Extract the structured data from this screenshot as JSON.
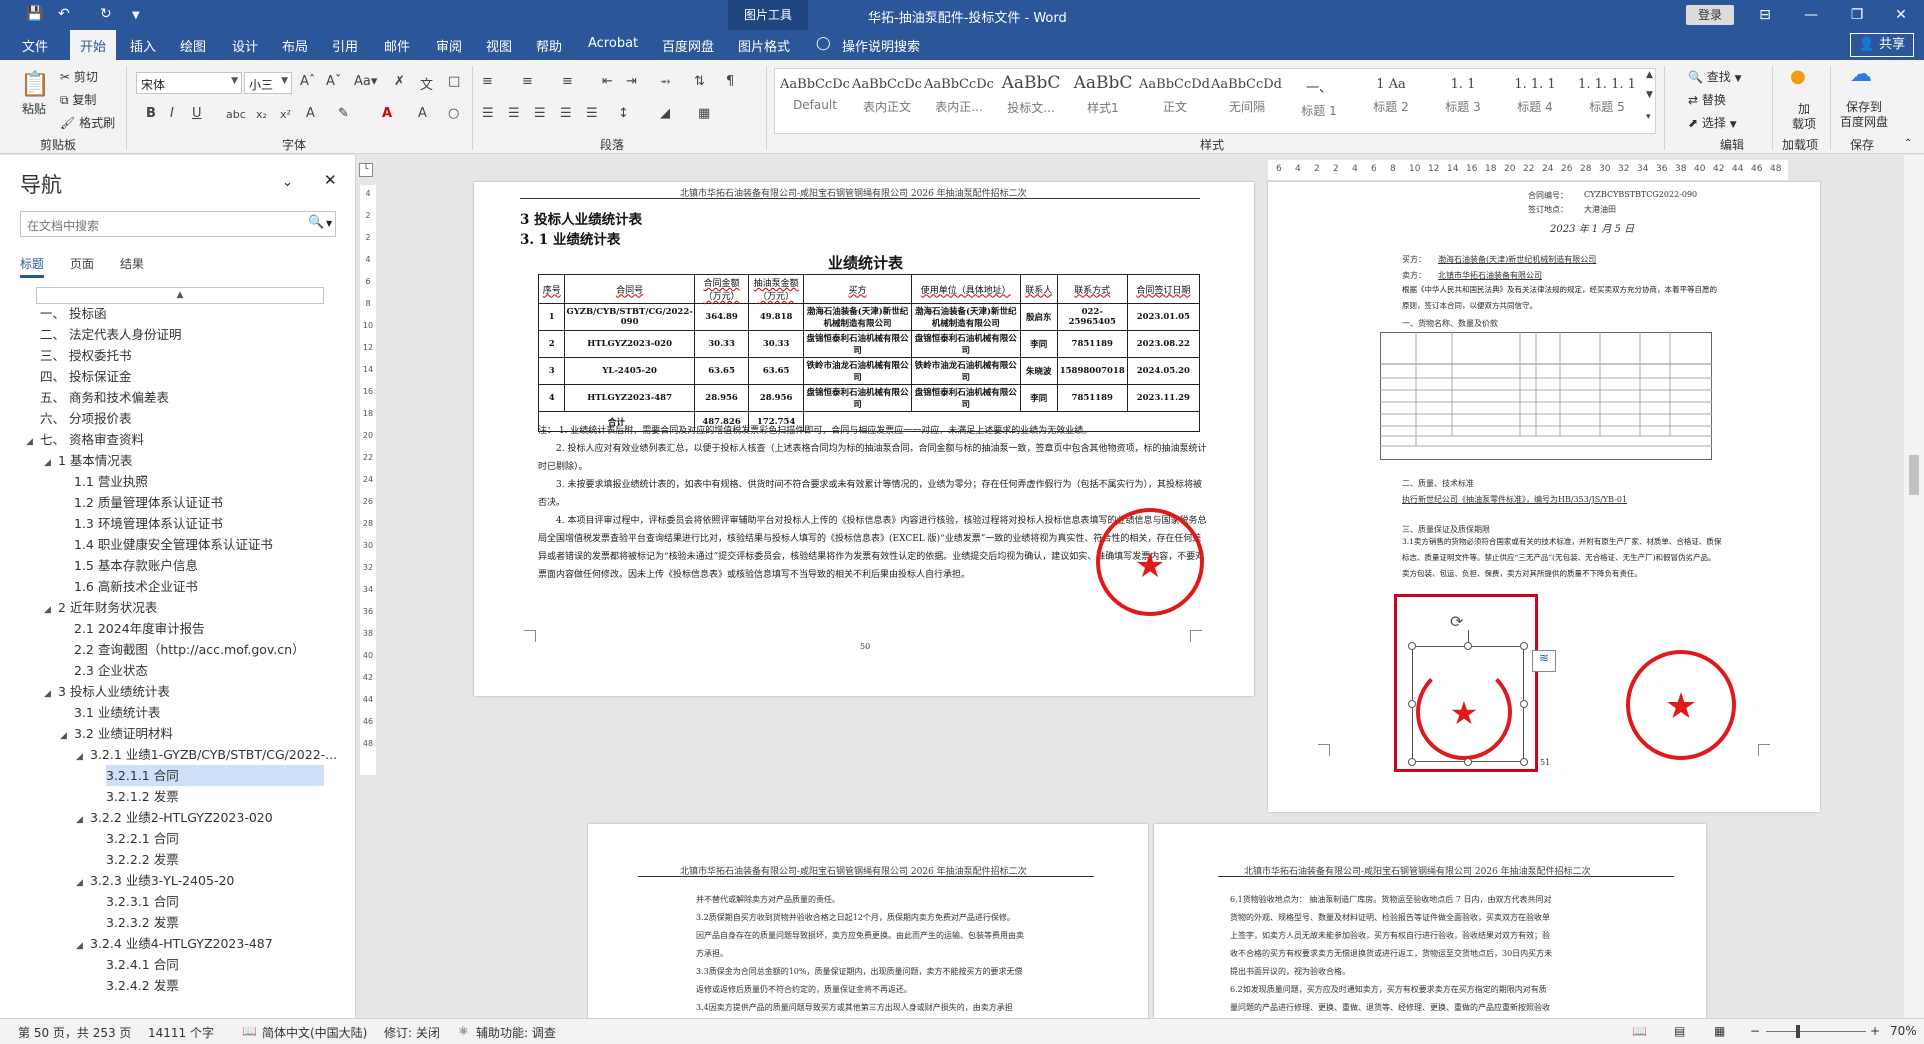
{
  "titlebar": {
    "context_tab": "图片工具",
    "doc_title": "华拓-抽油泵配件-投标文件  -  Word",
    "login": "登录",
    "min": "—",
    "restore": "❐",
    "close": "✕",
    "ribbon_opts": "⊟"
  },
  "tabs": [
    {
      "label": "文件"
    },
    {
      "label": "开始"
    },
    {
      "label": "插入"
    },
    {
      "label": "绘图"
    },
    {
      "label": "设计"
    },
    {
      "label": "布局"
    },
    {
      "label": "引用"
    },
    {
      "label": "邮件"
    },
    {
      "label": "审阅"
    },
    {
      "label": "视图"
    },
    {
      "label": "帮助"
    },
    {
      "label": "Acrobat"
    },
    {
      "label": "百度网盘"
    },
    {
      "label": "图片格式"
    }
  ],
  "tellme": "操作说明搜索",
  "share": "共享",
  "ribbon": {
    "clipboard": {
      "paste": "粘贴",
      "cut": "剪切",
      "copy": "复制",
      "painter": "格式刷",
      "label": "剪贴板"
    },
    "font": {
      "family": "宋体",
      "size": "小三",
      "label": "字体"
    },
    "paragraph": {
      "label": "段落"
    },
    "styles": {
      "label": "样式",
      "items": [
        {
          "sample": "AaBbCcDc",
          "name": "Default"
        },
        {
          "sample": "AaBbCcDc",
          "name": "表内正文"
        },
        {
          "sample": "AaBbCcDc",
          "name": "表内正..."
        },
        {
          "sample": "AaBbC",
          "name": "投标文..."
        },
        {
          "sample": "AaBbC",
          "name": "样式1"
        },
        {
          "sample": "AaBbCcDdI",
          "name": "正文"
        },
        {
          "sample": "AaBbCcDdI",
          "name": "无间隔"
        },
        {
          "sample": "一、",
          "name": "标题 1"
        },
        {
          "sample": "1  Aa",
          "name": "标题 2"
        },
        {
          "sample": "1. 1",
          "name": "标题 3"
        },
        {
          "sample": "1. 1. 1",
          "name": "标题 4"
        },
        {
          "sample": "1. 1. 1. 1",
          "name": "标题 5"
        }
      ]
    },
    "editing": {
      "find": "查找",
      "replace": "替换",
      "select": "选择",
      "label": "编辑"
    },
    "addins": {
      "name": "加\n载项",
      "label": "加载项"
    },
    "save": {
      "name": "保存到\n百度网盘",
      "label": "保存"
    }
  },
  "nav": {
    "title": "导航",
    "search_placeholder": "在文档中搜索",
    "tabs": [
      "标题",
      "页面",
      "结果"
    ],
    "collapse_glyph": "▲",
    "items": [
      {
        "text": "一、 投标函",
        "indent": 0,
        "tri": ""
      },
      {
        "text": "二、 法定代表人身份证明",
        "indent": 0,
        "tri": ""
      },
      {
        "text": "三、 授权委托书",
        "indent": 0,
        "tri": ""
      },
      {
        "text": "四、 投标保证金",
        "indent": 0,
        "tri": ""
      },
      {
        "text": "五、 商务和技术偏差表",
        "indent": 0,
        "tri": ""
      },
      {
        "text": "六、 分项报价表",
        "indent": 0,
        "tri": ""
      },
      {
        "text": "七、 资格审查资料",
        "indent": 0,
        "tri": "◢"
      },
      {
        "text": "1 基本情况表",
        "indent": 1,
        "tri": "◢"
      },
      {
        "text": "1.1 营业执照",
        "indent": 2,
        "tri": ""
      },
      {
        "text": "1.2 质量管理体系认证证书",
        "indent": 2,
        "tri": ""
      },
      {
        "text": "1.3 环境管理体系认证证书",
        "indent": 2,
        "tri": ""
      },
      {
        "text": "1.4 职业健康安全管理体系认证证书",
        "indent": 2,
        "tri": ""
      },
      {
        "text": "1.5 基本存款账户信息",
        "indent": 2,
        "tri": ""
      },
      {
        "text": "1.6 高新技术企业证书",
        "indent": 2,
        "tri": ""
      },
      {
        "text": "2 近年财务状况表",
        "indent": 1,
        "tri": "◢"
      },
      {
        "text": "2.1 2024年度审计报告",
        "indent": 2,
        "tri": ""
      },
      {
        "text": "2.2 查询截图（http://acc.mof.gov.cn）",
        "indent": 2,
        "tri": ""
      },
      {
        "text": "2.3 企业状态",
        "indent": 2,
        "tri": ""
      },
      {
        "text": "3 投标人业绩统计表",
        "indent": 1,
        "tri": "◢"
      },
      {
        "text": "3.1 业绩统计表",
        "indent": 2,
        "tri": ""
      },
      {
        "text": "3.2 业绩证明材料",
        "indent": 2,
        "tri": "◢"
      },
      {
        "text": "3.2.1 业绩1-GYZB/CYB/STBT/CG/2022-...",
        "indent": 3,
        "tri": "◢"
      },
      {
        "text": "3.2.1.1 合同",
        "indent": 4,
        "tri": "",
        "selected": true
      },
      {
        "text": "3.2.1.2 发票",
        "indent": 4,
        "tri": ""
      },
      {
        "text": "3.2.2 业绩2-HTLGYZ2023-020",
        "indent": 3,
        "tri": "◢"
      },
      {
        "text": "3.2.2.1 合同",
        "indent": 4,
        "tri": ""
      },
      {
        "text": "3.2.2.2 发票",
        "indent": 4,
        "tri": ""
      },
      {
        "text": "3.2.3 业绩3-YL-2405-20",
        "indent": 3,
        "tri": "◢"
      },
      {
        "text": "3.2.3.1 合同",
        "indent": 4,
        "tri": ""
      },
      {
        "text": "3.2.3.2 发票",
        "indent": 4,
        "tri": ""
      },
      {
        "text": "3.2.4 业绩4-HTLGYZ2023-487",
        "indent": 3,
        "tri": "◢"
      },
      {
        "text": "3.2.4.1 合同",
        "indent": 4,
        "tri": ""
      },
      {
        "text": "3.2.4.2 发票",
        "indent": 4,
        "tri": ""
      }
    ]
  },
  "vruler": [
    "4",
    "2",
    "2",
    "4",
    "6",
    "8",
    "10",
    "12",
    "14",
    "16",
    "18",
    "20",
    "22",
    "24",
    "26",
    "28",
    "30",
    "32",
    "34",
    "36",
    "38",
    "40",
    "42",
    "44",
    "46",
    "48"
  ],
  "hruler": [
    "6",
    "4",
    "2",
    "2",
    "4",
    "6",
    "8",
    "10",
    "12",
    "14",
    "16",
    "18",
    "20",
    "22",
    "24",
    "26",
    "28",
    "30",
    "32",
    "34",
    "36",
    "38",
    "40",
    "42",
    "44",
    "46",
    "48"
  ],
  "page50": {
    "header": "北镇市华拓石油装备有限公司-咸阳宝石钢管钢绳有限公司 2026 年抽油泵配件招标二次",
    "h1": "3 投标人业绩统计表",
    "h2": "3. 1 业绩统计表",
    "table_title": "业绩统计表",
    "columns": [
      "序号",
      "合同号",
      "合同金额（万元）",
      "抽油泵金额（万元）",
      "买方",
      "使用单位（具体地址）",
      "联系人",
      "联系方式",
      "合同签订日期"
    ],
    "rows": [
      [
        "1",
        "GYZB/CYB/STBT/CG/2022-090",
        "364.89",
        "49.818",
        "渤海石油装备(天津)新世纪机械制造有限公司",
        "渤海石油装备(天津)新世纪机械制造有限公司",
        "殷启东",
        "022-25965405",
        "2023.01.05"
      ],
      [
        "2",
        "HTLGYZ2023-020",
        "30.33",
        "30.33",
        "盘锦恒泰利石油机械有限公司",
        "盘锦恒泰利石油机械有限公司",
        "李同",
        "7851189",
        "2023.08.22"
      ],
      [
        "3",
        "YL-2405-20",
        "63.65",
        "63.65",
        "铁岭市油龙石油机械有限公司",
        "铁岭市油龙石油机械有限公司",
        "朱晓波",
        "15898007018",
        "2024.05.20"
      ],
      [
        "4",
        "HTLGYZ2023-487",
        "28.956",
        "28.956",
        "盘锦恒泰利石油机械有限公司",
        "盘锦恒泰利石油机械有限公司",
        "李同",
        "7851189",
        "2023.11.29"
      ]
    ],
    "total_label": "合计",
    "total_contract": "487.826",
    "total_pump": "172.754",
    "notes": [
      "注：  1. 业绩统计表后附，需要合同及对应的增值税发票彩色扫描件即可，合同与相应发票应一一对应，未满足上述要求的业绩为无效业绩。",
      "2. 投标人应对有效业绩列表汇总，以便于投标人核查（上述表格合同均为标的抽油泵合同，合同金额与标的抽油泵一致，签章页中包含其他物资项，标的抽油泵统计时已剔除）。",
      "3. 未按要求填报业绩统计表的，如表中有规格、供货时间不符合要求或未有效累计等情况的，业绩为零分；存在任何弄虚作假行为（包括不属实行为），其投标将被否决。",
      "4. 本项目评审过程中，评标委员会将依照评审辅助平台对投标人上传的《投标信息表》内容进行核验，核验过程将对投标人投标信息表填写的业绩信息与国家税务总局全国增值税发票查验平台查询结果进行比对，核验结果与投标人填写的《投标信息表》(EXCEL 版)“业绩发票”一致的业绩将视为真实性、符合性的相关，存在任何差异或者错误的发票都将被标记为“核验未通过”提交评标委员会，核验结果将作为发票有效性认定的依据。业绩提交后均视为确认，建议如实、准确填写发票内容，不要对票面内容做任何修改。因未上传《投标信息表》或核验信息填写不当导致的相关不利后果由投标人自行承担。"
    ],
    "page_no": "50"
  },
  "page51": {
    "contract_no_label": "合同编号：",
    "contract_no": "CYZBCYBSTBTCG2022-090",
    "place_label": "签订地点：",
    "place": "大港油田",
    "date_hand": "2023 年 1 月 5 日",
    "buyer_label": "买方：",
    "buyer": "渤海石油装备(天津)新世纪机械制造有限公司",
    "seller_label": "卖方：",
    "seller": "北镇市华拓石油装备有限公司",
    "intro": "根据《中华人民共和国民法典》及有关法律法规的规定，经买卖双方充分协商，本着平等自愿的原则，签订本合同，以便双方共同信守。",
    "sec1": "一、货物名称、数量及价款",
    "sec2": "二、质量、技术标准",
    "sec2_text": "执行新世纪公司《抽油泵零件标准》，编号为HB/353/JS/YB-01",
    "sec3": "三、质量保证及质保期限",
    "sec3_text": "3.1卖方销售的货物必须符合国家或有关的技术标准，并附有原生产厂家、材质单、合格证、质保标志、质量证明文件等。禁止供应“三无产品”(无包装、无合格证、无生产厂)和假冒伪劣产品。卖方包装、包运、负担、保费，卖方对其所提供的质量不下降负有责任。",
    "page_no": "51",
    "seal_text": "北镇市华拓石油装备有限公司"
  },
  "page52": {
    "header": "北镇市华拓石油装备有限公司-咸阳宝石钢管钢绳有限公司 2026 年抽油泵配件招标二次",
    "lines": [
      "并不替代或解除卖方对产品质量的责任。",
      "3.2质保期自买方收到货物并验收合格之日起12个月，质保期内卖方免费对产品进行保修。",
      "因产品自身存在的质量问题导致损坏，卖方应免费更换。由此而产生的运输、包装等费用由卖",
      "方承担。",
      "3.3质保金为合同总金额的10%，质量保证期内，出现质量问题，卖方不能按买方的要求无偿",
      "返修或返修后质量仍不符合约定的，质量保证金将不再返还。",
      "3.4因卖方提供产品的质量问题导致买方或其他第三方出现人身或财产损失的，由卖方承担"
    ]
  },
  "page53": {
    "header": "北镇市华拓石油装备有限公司-咸阳宝石钢管钢绳有限公司 2026 年抽油泵配件招标二次",
    "lines": [
      "6.1货物验收地点为：  抽油泵制造厂库房。货物运至验收地点后 7 日内，由双方代表共同对",
      "货物的外观、规格型号、数量及材料证明、检验报告等证件做全面验收，买卖双方在验收单",
      "上签字，如卖方人员无故未能参加验收，买方有权自行进行验收，验收结果对双方有效；验",
      "收不合格的买方有权要求卖方无偿退换货或进行返工，货物运至交货地点后，30日内买方未",
      "提出书面异议的，视为验收合格。",
      "6.2如发现质量问题，买方应及时通知卖方，买方有权要求卖方在买方指定的期限内对有质",
      "量问题的产品进行修理、更换、重做、退货等、经修理、更换、重做的产品应重新按照验收"
    ]
  },
  "status": {
    "page": "第 50 页，共 253 页",
    "words": "14111 个字",
    "lang": "简体中文(中国大陆)",
    "track": "修订: 关闭",
    "access": "辅助功能: 调查",
    "zoom": "70%"
  }
}
